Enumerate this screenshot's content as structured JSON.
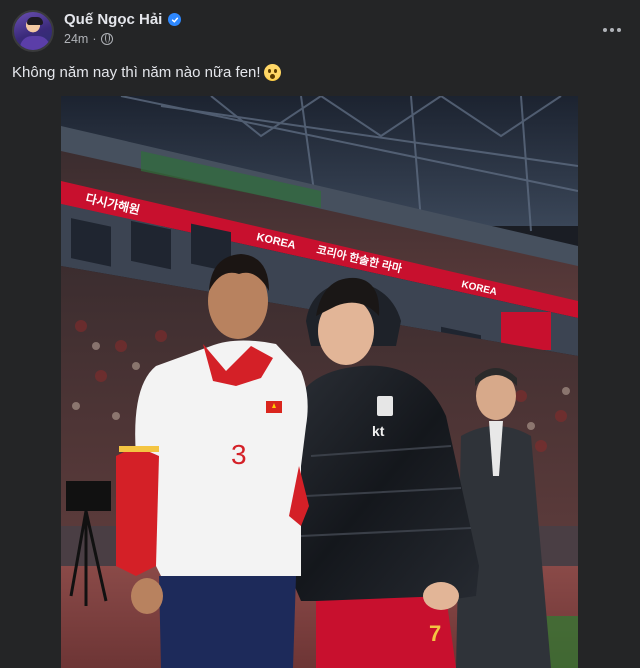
{
  "post": {
    "author_name": "Quế Ngọc Hải",
    "timestamp": "24m",
    "privacy_icon": "globe-icon",
    "verified_icon": "verified-badge-icon",
    "more_icon": "more-options-icon",
    "caption": "Không năm nay thì năm nào nữa fen!",
    "caption_emoji": "astonished-face-emoji"
  },
  "photo": {
    "banner_texts": [
      "다시가해원",
      "KOREA",
      "코리아 한솔한 라마",
      "KOREA"
    ],
    "left_player": {
      "shirt_number": "3"
    },
    "right_player": {
      "jacket_logo": "kt",
      "shorts_number": "7"
    }
  },
  "colors": {
    "background": "#242526",
    "primary_text": "#e4e6eb",
    "secondary_text": "#b0b3b8",
    "verified_blue": "#2d88ff",
    "banner_red": "#c8102e"
  }
}
